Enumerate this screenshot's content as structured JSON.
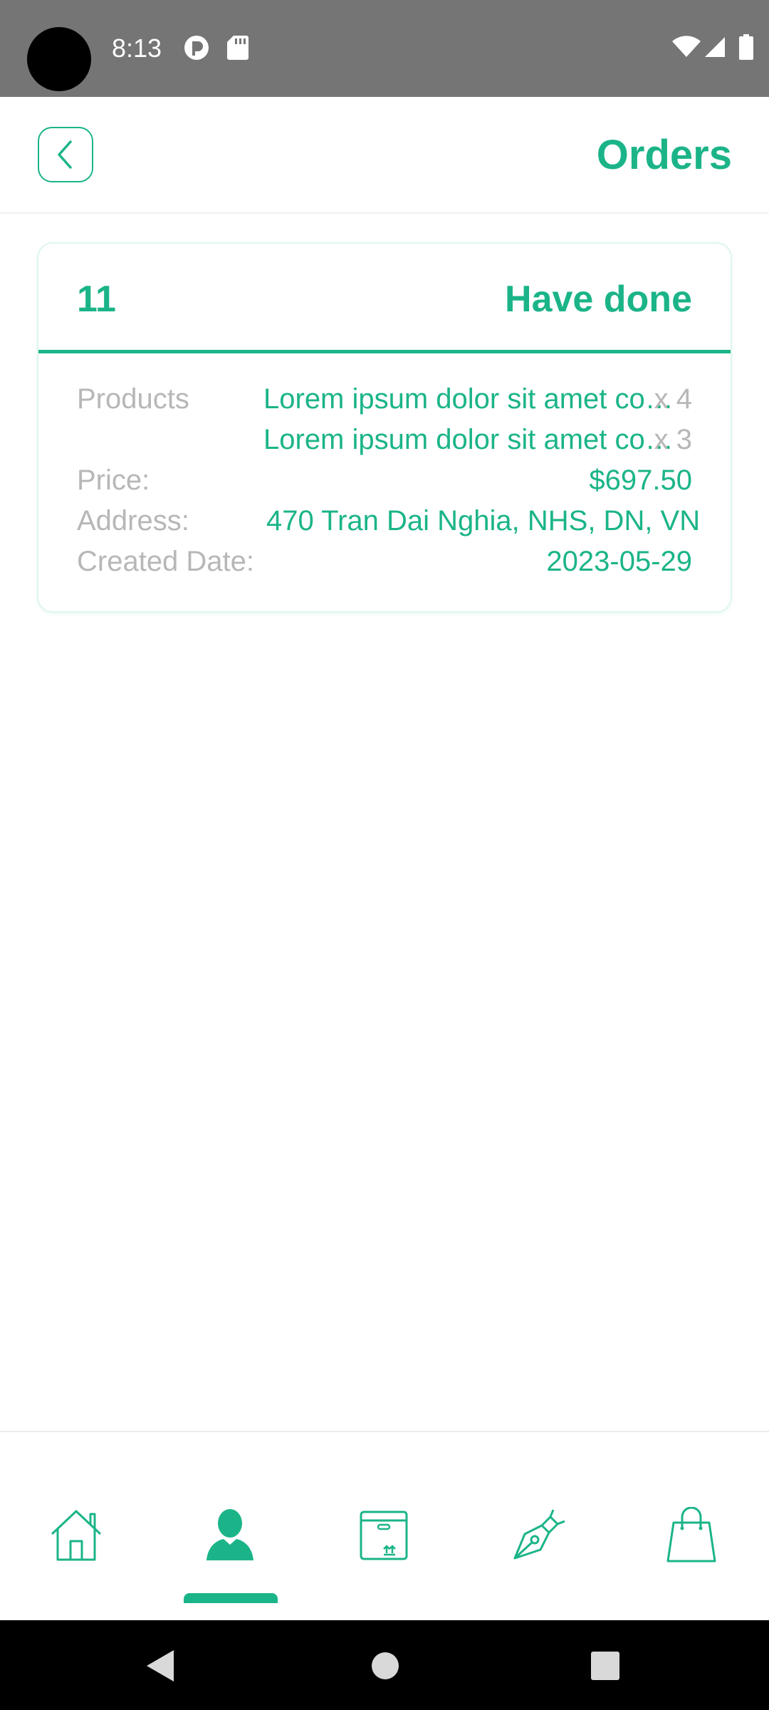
{
  "status_bar": {
    "time": "8:13"
  },
  "app_bar": {
    "title": "Orders",
    "back_icon": "chevron-left-icon"
  },
  "order": {
    "id": "11",
    "status": "Have done",
    "labels": {
      "products": "Products",
      "price": "Price:",
      "address": "Address:",
      "created_date": "Created Date:"
    },
    "products": [
      {
        "name": "Lorem ipsum dolor sit amet co…",
        "qty": "x 4"
      },
      {
        "name": "Lorem ipsum dolor sit amet co…",
        "qty": "x 3"
      }
    ],
    "price": "$697.50",
    "address": "470 Tran Dai Nghia, NHS, DN, VN",
    "created_date": "2023-05-29"
  },
  "bottom_nav": {
    "items": [
      "home-icon",
      "user-icon",
      "box-icon",
      "pen-icon",
      "shopping-bag-icon"
    ],
    "active_index": 1
  },
  "colors": {
    "accent": "#1bb488",
    "label_gray": "#b7b7b7",
    "status_bar": "#757575"
  }
}
